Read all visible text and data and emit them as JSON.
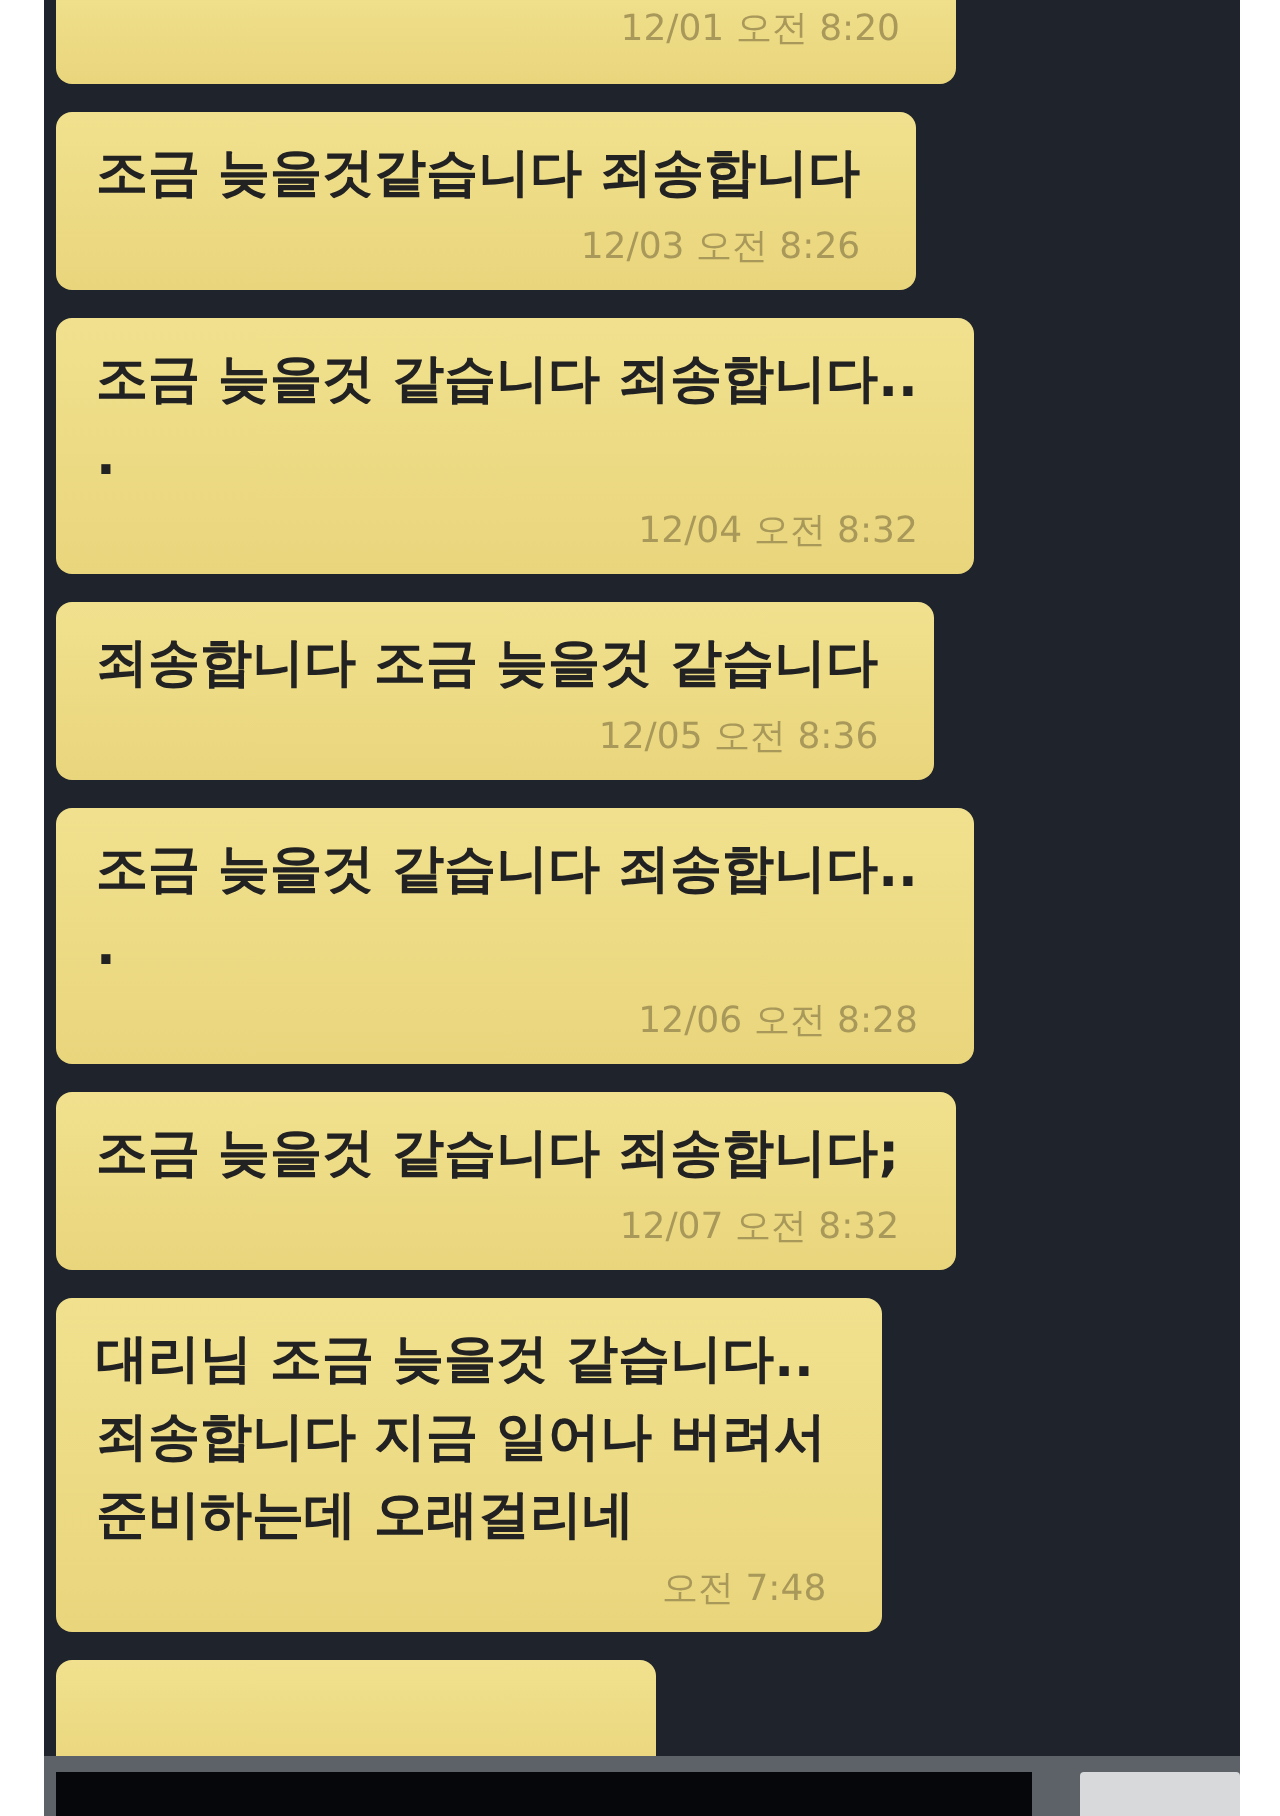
{
  "messages": [
    {
      "time": "12/01 오전 8:20",
      "kind": "clipped"
    },
    {
      "text": "조금 늦을것같습니다 죄송합니다",
      "time": "12/03 오전 8:26",
      "kind": "full"
    },
    {
      "text": "조금 늦을것 같습니다 죄송합니다..\n.",
      "time": "12/04 오전 8:32",
      "kind": "full"
    },
    {
      "text": "죄송합니다 조금 늦을것 같습니다",
      "time": "12/05 오전 8:36",
      "kind": "full"
    },
    {
      "text": "조금 늦을것 같습니다 죄송합니다..\n.",
      "time": "12/06 오전 8:28",
      "kind": "full"
    },
    {
      "text": "조금 늦을것 같습니다 죄송합니다;",
      "time": "12/07 오전 8:32",
      "kind": "full"
    },
    {
      "text": "대리님 조금 늦을것 같습니다..\n죄송합니다 지금 일어나 버려서\n준비하는데 오래걸리네",
      "time": "오전 7:48",
      "kind": "full"
    },
    {
      "kind": "partial"
    }
  ]
}
